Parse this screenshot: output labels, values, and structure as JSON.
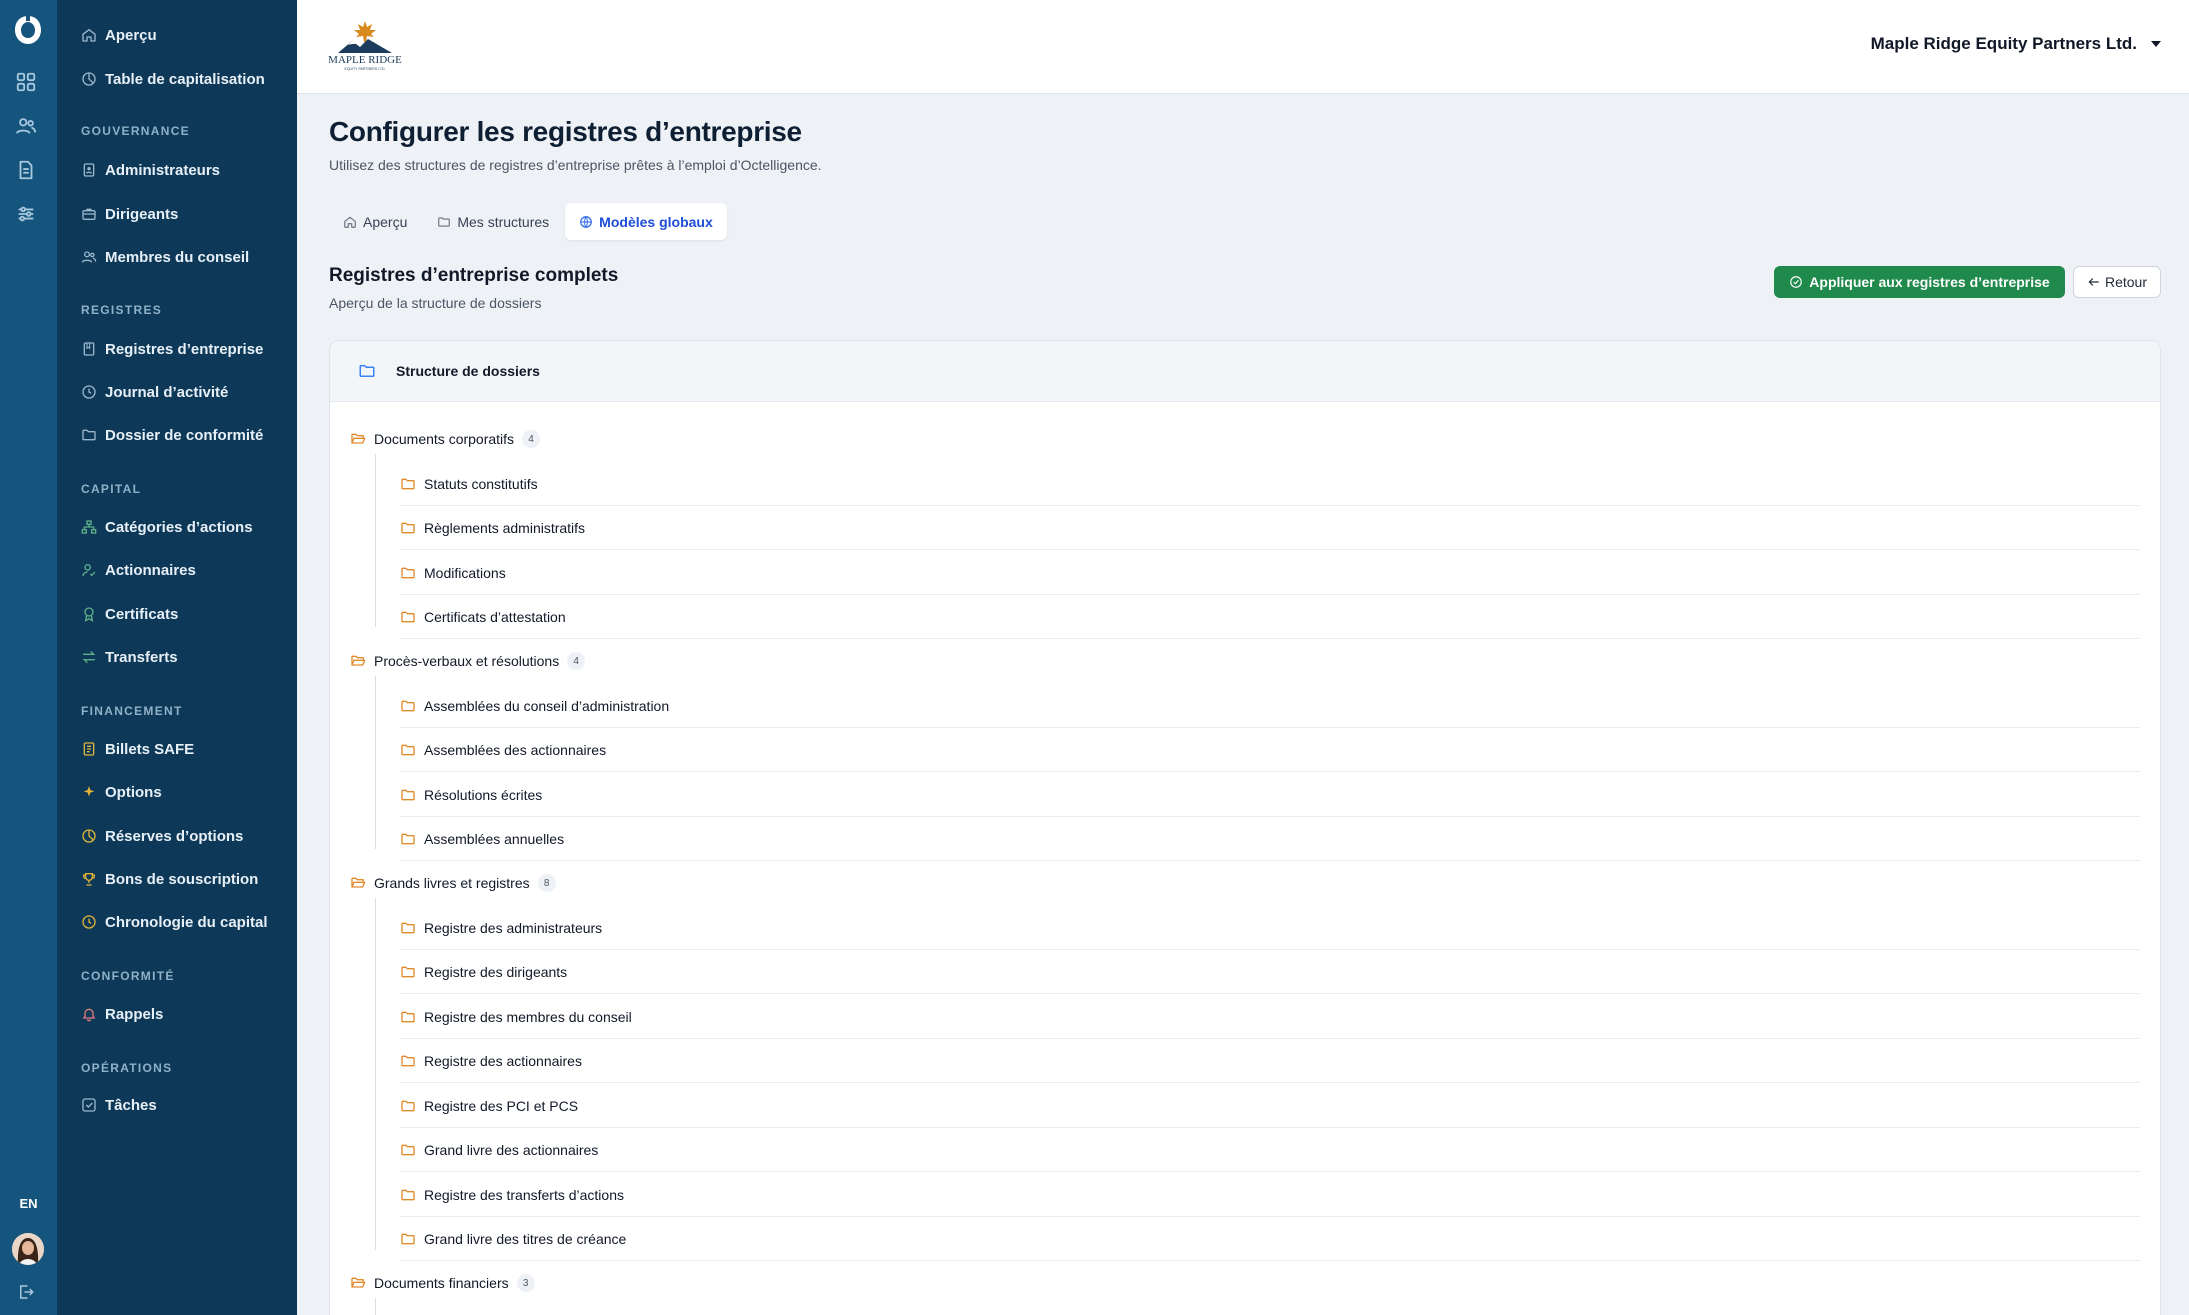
{
  "rail": {
    "language": "EN",
    "icons": [
      "app-logo",
      "grid-icon",
      "users-icon",
      "document-icon",
      "sliders-icon",
      "logout-icon"
    ]
  },
  "sidebar": {
    "top_items": [
      {
        "label": "Aperçu",
        "icon": "home-icon"
      },
      {
        "label": "Table de capitalisation",
        "icon": "pie-chart-icon"
      }
    ],
    "sections": [
      {
        "title": "GOUVERNANCE",
        "items": [
          {
            "label": "Administrateurs",
            "icon": "id-badge-icon"
          },
          {
            "label": "Dirigeants",
            "icon": "briefcase-icon"
          },
          {
            "label": "Membres du conseil",
            "icon": "users-icon"
          }
        ]
      },
      {
        "title": "REGISTRES",
        "items": [
          {
            "label": "Registres d’entreprise",
            "icon": "book-icon"
          },
          {
            "label": "Journal d’activité",
            "icon": "clock-icon"
          },
          {
            "label": "Dossier de conformité",
            "icon": "folder-icon"
          }
        ]
      },
      {
        "title": "CAPITAL",
        "items": [
          {
            "label": "Catégories d’actions",
            "icon": "hierarchy-icon"
          },
          {
            "label": "Actionnaires",
            "icon": "user-check-icon"
          },
          {
            "label": "Certificats",
            "icon": "award-icon"
          },
          {
            "label": "Transferts",
            "icon": "transfer-icon"
          }
        ]
      },
      {
        "title": "FINANCEMENT",
        "items": [
          {
            "label": "Billets SAFE",
            "icon": "note-icon"
          },
          {
            "label": "Options",
            "icon": "sparkle-icon"
          },
          {
            "label": "Réserves d’options",
            "icon": "pie-chart-icon"
          },
          {
            "label": "Bons de souscription",
            "icon": "trophy-icon"
          },
          {
            "label": "Chronologie du capital",
            "icon": "clock-icon"
          }
        ]
      },
      {
        "title": "CONFORMITÉ",
        "items": [
          {
            "label": "Rappels",
            "icon": "bell-icon"
          }
        ]
      },
      {
        "title": "OPÉRATIONS",
        "items": [
          {
            "label": "Tâches",
            "icon": "check-square-icon"
          }
        ]
      }
    ]
  },
  "topbar": {
    "brand_logo_text": "MAPLE RIDGE",
    "brand_logo_subtext": "EQUITY PARTNERS LTD.",
    "company": "Maple Ridge Equity Partners Ltd."
  },
  "main": {
    "title": "Configurer les registres d’entreprise",
    "subtitle": "Utilisez des structures de registres d’entreprise prêtes à l’emploi d’Octelligence.",
    "tabs": [
      {
        "label": "Aperçu",
        "icon": "home-icon",
        "active": false
      },
      {
        "label": "Mes structures",
        "icon": "folder-icon",
        "active": false
      },
      {
        "label": "Modèles globaux",
        "icon": "globe-icon",
        "active": true
      }
    ],
    "section_title": "Registres d’entreprise complets",
    "section_subtitle": "Aperçu de la structure de dossiers",
    "apply_button": "Appliquer aux registres d’entreprise",
    "back_button": "Retour",
    "card_title": "Structure de dossiers",
    "folders": [
      {
        "name": "Documents corporatifs",
        "count": "4",
        "children": [
          "Statuts constitutifs",
          "Règlements administratifs",
          "Modifications",
          "Certificats d’attestation"
        ]
      },
      {
        "name": "Procès-verbaux et résolutions",
        "count": "4",
        "children": [
          "Assemblées du conseil d’administration",
          "Assemblées des actionnaires",
          "Résolutions écrites",
          "Assemblées annuelles"
        ]
      },
      {
        "name": "Grands livres et registres",
        "count": "8",
        "children": [
          "Registre des administrateurs",
          "Registre des dirigeants",
          "Registre des membres du conseil",
          "Registre des actionnaires",
          "Registre des PCI et PCS",
          "Grand livre des actionnaires",
          "Registre des transferts d’actions",
          "Grand livre des titres de créance"
        ]
      },
      {
        "name": "Documents financiers",
        "count": "3",
        "children": []
      }
    ]
  },
  "colors": {
    "rail": "#14547d",
    "sidebar": "#0d3857",
    "accent_blue": "#1d4ed8",
    "apply_green": "#1f8a4c",
    "folder_orange": "#e08a2c"
  }
}
